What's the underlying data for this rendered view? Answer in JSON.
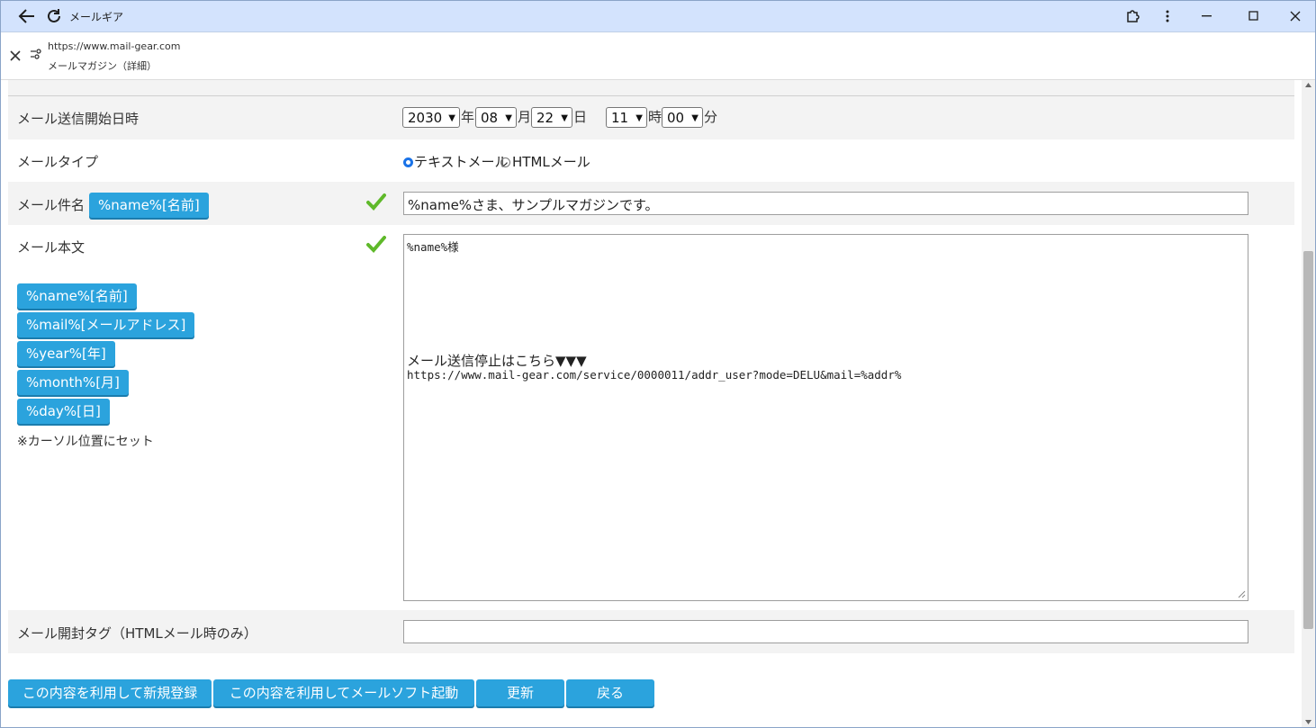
{
  "browser": {
    "window_title": "メールギア",
    "url": "https://www.mail-gear.com",
    "page_title": "メールマガジン（詳細）"
  },
  "form": {
    "send_datetime": {
      "label": "メール送信開始日時",
      "year": "2030",
      "year_unit": "年",
      "month": "08",
      "month_unit": "月",
      "day": "22",
      "day_unit": "日",
      "hour": "11",
      "hour_unit": "時",
      "minute": "00",
      "minute_unit": "分"
    },
    "mail_type": {
      "label": "メールタイプ",
      "options": [
        "テキストメール",
        "HTMLメール"
      ],
      "selected": "テキストメール"
    },
    "subject": {
      "label": "メール件名",
      "insert_button": "%name%[名前]",
      "value": "%name%さま、サンプルマガジンです。"
    },
    "body": {
      "label": "メール本文",
      "insert_buttons": [
        "%name%[名前]",
        "%mail%[メールアドレス]",
        "%year%[年]",
        "%month%[月]",
        "%day%[日]"
      ],
      "note": "※カーソル位置にセット",
      "line1": "%name%様",
      "line2": "メール送信停止はこちら▼▼▼",
      "line3": "https://www.mail-gear.com/service/0000011/addr_user?mode=DELU&mail=%addr%"
    },
    "open_tag": {
      "label": "メール開封タグ（HTMLメール時のみ）",
      "value": ""
    }
  },
  "actions": {
    "new_register": "この内容を利用して新規登録",
    "mail_soft": "この内容を利用してメールソフト起動",
    "update": "更新",
    "back": "戻る"
  },
  "colors": {
    "button_blue": "#2ba3dd",
    "titlebar": "#d3e3fd",
    "row_gray": "#f3f3f3",
    "check_green": "#5fb92a"
  }
}
